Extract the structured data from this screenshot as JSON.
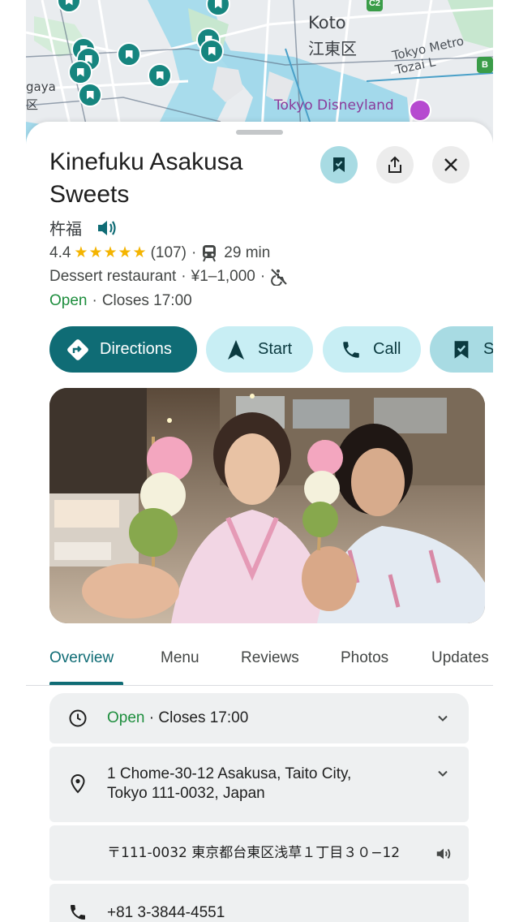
{
  "map": {
    "labels": {
      "koto": "Koto",
      "koto_jp": "江東区",
      "tozai": "Tokyo Metro Tozai L",
      "disney": "Tokyo Disneyland",
      "left_top": "gaya",
      "left_bottom": "区"
    },
    "badges": {
      "c2": "C2",
      "b": "B"
    },
    "colors": {
      "pin": "#16857f",
      "water": "#9fd9ec",
      "park": "#c7e7cf",
      "land": "#e9ecef"
    }
  },
  "place": {
    "title": "Kinefuku Asakusa Sweets",
    "native_name": "杵福",
    "rating": "4.4",
    "stars": "★★★★★",
    "review_count": "(107)",
    "transit_time": "29 min",
    "category": "Dessert restaurant",
    "price": "¥1–1,000",
    "open_status": "Open",
    "closes": "Closes 17:00"
  },
  "header_icons": [
    "bookmark-icon",
    "share-icon",
    "close-icon"
  ],
  "actions": {
    "directions": "Directions",
    "start": "Start",
    "call": "Call",
    "save": "Sa"
  },
  "tabs": [
    "Overview",
    "Menu",
    "Reviews",
    "Photos",
    "Updates"
  ],
  "active_tab": "Overview",
  "info": {
    "hours_status": "Open",
    "hours_closes": "Closes 17:00",
    "address_line1": "1 Chome-30-12 Asakusa, Taito City,",
    "address_line2": "Tokyo 111-0032, Japan",
    "address_jp": "〒111-0032 東京都台東区浅草１丁目３０−12",
    "phone": "+81 3-3844-4551"
  },
  "colors": {
    "accent": "#0f6c75",
    "chip_light": "#c8eef4",
    "open_green": "#1e8e3e",
    "star": "#f4b400"
  }
}
